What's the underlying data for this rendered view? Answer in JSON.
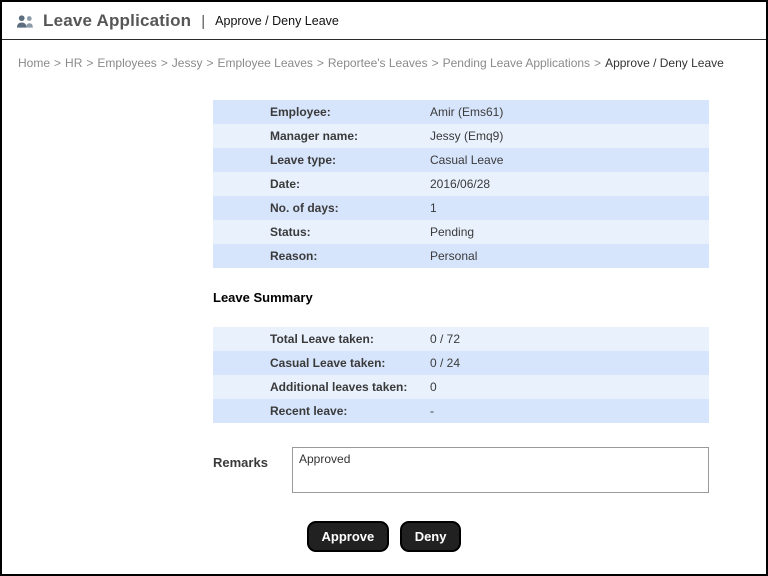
{
  "header": {
    "title": "Leave Application",
    "subtitle": "Approve / Deny Leave"
  },
  "breadcrumb": {
    "separator": ">",
    "items": [
      "Home",
      "HR",
      "Employees",
      "Jessy",
      "Employee Leaves",
      "Reportee's Leaves",
      "Pending Leave Applications",
      "Approve / Deny Leave"
    ]
  },
  "details": {
    "rows": [
      {
        "label": "Employee:",
        "value": "Amir (Ems61)"
      },
      {
        "label": "Manager name:",
        "value": "Jessy (Emq9)"
      },
      {
        "label": "Leave type:",
        "value": "Casual Leave"
      },
      {
        "label": "Date:",
        "value": "2016/06/28"
      },
      {
        "label": "No. of days:",
        "value": "1"
      },
      {
        "label": "Status:",
        "value": "Pending"
      },
      {
        "label": "Reason:",
        "value": "Personal"
      }
    ]
  },
  "summary": {
    "heading": "Leave Summary",
    "rows": [
      {
        "label": "Total Leave taken:",
        "value": "0 / 72"
      },
      {
        "label": "Casual Leave taken:",
        "value": "0 / 24"
      },
      {
        "label": "Additional leaves taken:",
        "value": "0"
      },
      {
        "label": "Recent leave:",
        "value": "-"
      }
    ]
  },
  "remarks": {
    "label": "Remarks",
    "value": "Approved"
  },
  "actions": {
    "approve_label": "Approve",
    "deny_label": "Deny"
  },
  "colors": {
    "row_dark": "#d7e5fc",
    "row_light": "#e9f1fd",
    "button_bg": "#212121"
  }
}
